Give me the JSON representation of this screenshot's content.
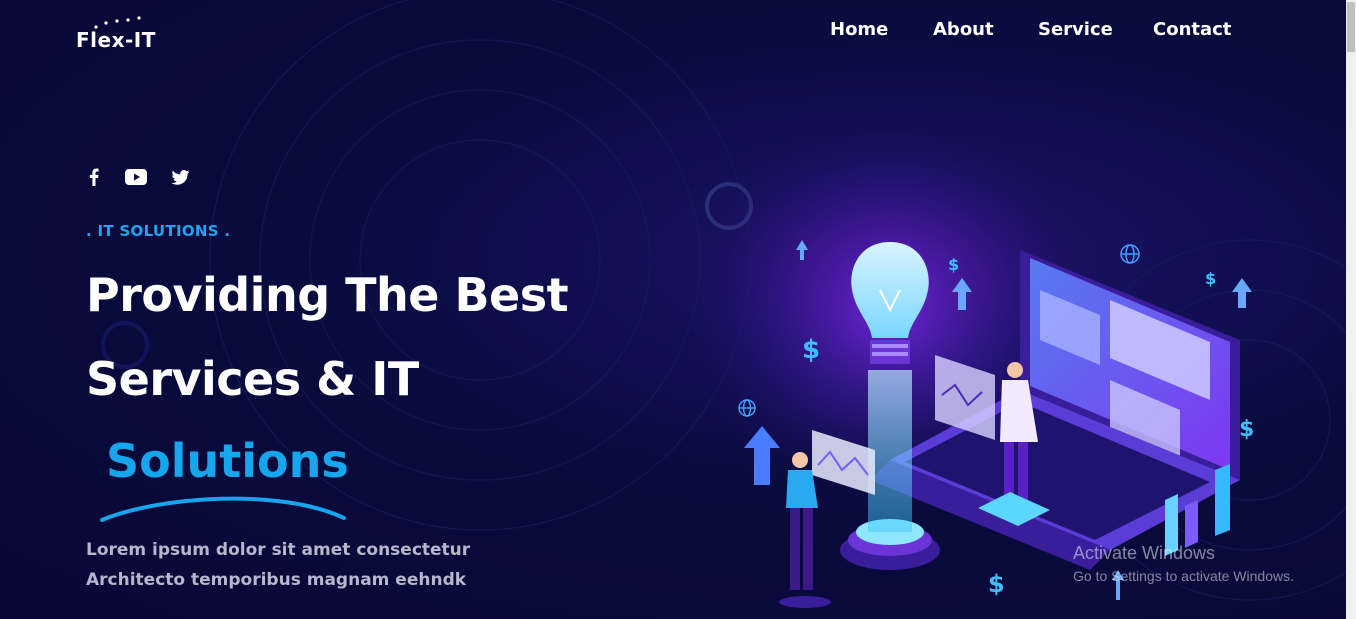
{
  "brand": {
    "name": "Flex-IT",
    "icon": "logo-dots"
  },
  "nav": {
    "items": [
      {
        "label": "Home"
      },
      {
        "label": "About"
      },
      {
        "label": "Service"
      },
      {
        "label": "Contact"
      }
    ]
  },
  "social": [
    {
      "icon": "facebook-icon"
    },
    {
      "icon": "youtube-icon"
    },
    {
      "icon": "twitter-icon"
    }
  ],
  "hero": {
    "kicker": ". IT SOLUTIONS .",
    "title_line1": "Providing The Best",
    "title_line2": "Services & IT",
    "title_line3": "Solutions",
    "desc_line1": "Lorem ipsum dolor sit amet consectetur",
    "desc_line2": "Architecto temporibus magnam eehndk"
  },
  "watermark": {
    "title": "Activate Windows",
    "subtitle": "Go to Settings to activate Windows."
  },
  "colors": {
    "background": "#08093a",
    "accent": "#16a6ee",
    "glow": "#7b2ff2",
    "muted_text": "#b6b7cc"
  }
}
